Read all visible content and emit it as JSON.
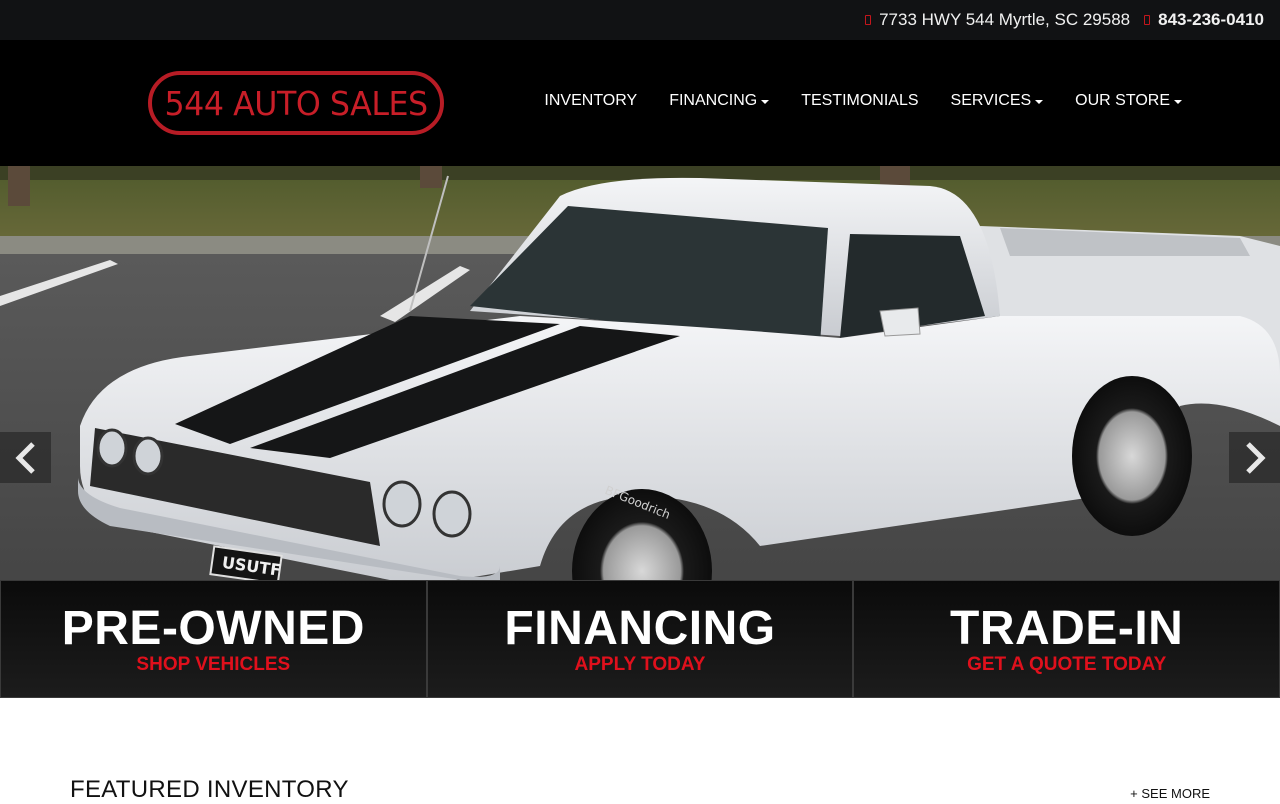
{
  "topbar": {
    "address": "7733 HWY 544 Myrtle, SC 29588",
    "phone": "843-236-0410"
  },
  "header": {
    "logo_text": "544 AUTO SALES",
    "nav": [
      {
        "label": "INVENTORY",
        "dropdown": false
      },
      {
        "label": "FINANCING",
        "dropdown": true
      },
      {
        "label": "TESTIMONIALS",
        "dropdown": false
      },
      {
        "label": "SERVICES",
        "dropdown": true
      },
      {
        "label": "OUR STORE",
        "dropdown": true
      }
    ]
  },
  "hero": {
    "plate_text": "USUTF",
    "tire_text": "BFGoodrich"
  },
  "tiles": [
    {
      "title": "PRE-OWNED",
      "cta": "SHOP VEHICLES"
    },
    {
      "title": "FINANCING",
      "cta": "APPLY TODAY"
    },
    {
      "title": "TRADE-IN",
      "cta": "GET A QUOTE TODAY"
    }
  ],
  "featured": {
    "title": "FEATURED INVENTORY",
    "see_more": "+ SEE MORE"
  },
  "colors": {
    "brand_red": "#c81e28",
    "cta_red": "#e0101c",
    "header_bg": "#000000",
    "topbar_bg": "#111214"
  }
}
